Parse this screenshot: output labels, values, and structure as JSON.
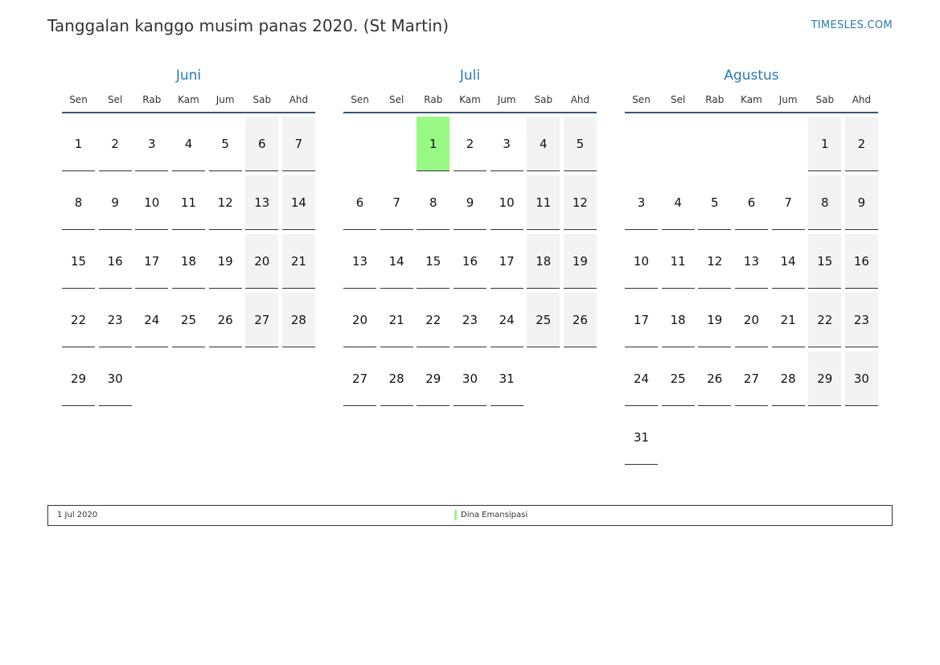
{
  "header": {
    "title": "Tanggalan kanggo musim panas 2020. (St Martin)",
    "brand": "TIMESLES.COM"
  },
  "weekdays": [
    "Sen",
    "Sel",
    "Rab",
    "Kam",
    "Jum",
    "Sab",
    "Ahd"
  ],
  "colors": {
    "accent": "#2a7ab8",
    "holiday": "#98f984",
    "weekend": "#f3f3f3",
    "rule": "#3a5578"
  },
  "months": [
    {
      "name": "Juni",
      "weeks": [
        [
          "1",
          "2",
          "3",
          "4",
          "5",
          "6",
          "7"
        ],
        [
          "8",
          "9",
          "10",
          "11",
          "12",
          "13",
          "14"
        ],
        [
          "15",
          "16",
          "17",
          "18",
          "19",
          "20",
          "21"
        ],
        [
          "22",
          "23",
          "24",
          "25",
          "26",
          "27",
          "28"
        ],
        [
          "29",
          "30",
          "",
          "",
          "",
          "",
          ""
        ]
      ]
    },
    {
      "name": "Juli",
      "weeks": [
        [
          "",
          "",
          "1",
          "2",
          "3",
          "4",
          "5"
        ],
        [
          "6",
          "7",
          "8",
          "9",
          "10",
          "11",
          "12"
        ],
        [
          "13",
          "14",
          "15",
          "16",
          "17",
          "18",
          "19"
        ],
        [
          "20",
          "21",
          "22",
          "23",
          "24",
          "25",
          "26"
        ],
        [
          "27",
          "28",
          "29",
          "30",
          "31",
          "",
          ""
        ]
      ]
    },
    {
      "name": "Agustus",
      "weeks": [
        [
          "",
          "",
          "",
          "",
          "",
          "1",
          "2"
        ],
        [
          "3",
          "4",
          "5",
          "6",
          "7",
          "8",
          "9"
        ],
        [
          "10",
          "11",
          "12",
          "13",
          "14",
          "15",
          "16"
        ],
        [
          "17",
          "18",
          "19",
          "20",
          "21",
          "22",
          "23"
        ],
        [
          "24",
          "25",
          "26",
          "27",
          "28",
          "29",
          "30"
        ],
        [
          "31",
          "",
          "",
          "",
          "",
          "",
          ""
        ]
      ]
    }
  ],
  "holidays": [
    {
      "month": "Juli",
      "day": "1",
      "date_label": "1 Jul 2020",
      "name": "Dina Emansipasi"
    }
  ]
}
